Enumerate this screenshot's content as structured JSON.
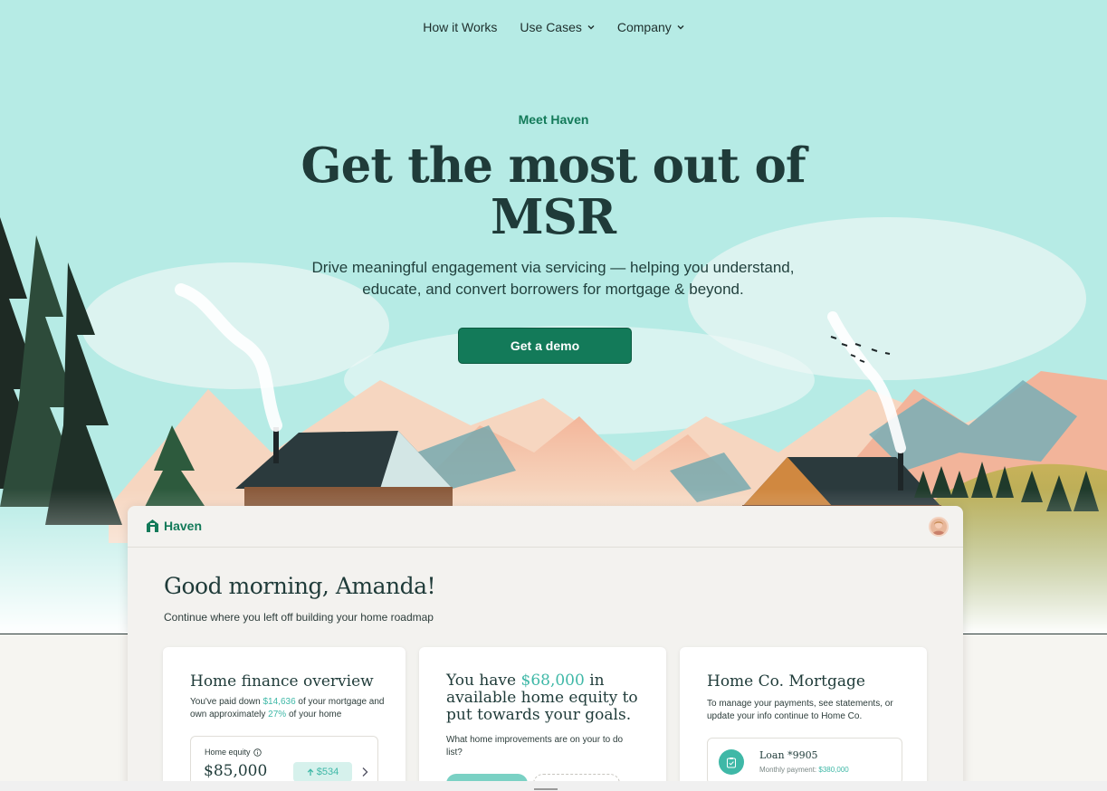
{
  "nav": {
    "items": [
      {
        "label": "How it Works",
        "has_dropdown": false
      },
      {
        "label": "Use Cases",
        "has_dropdown": true
      },
      {
        "label": "Company",
        "has_dropdown": true
      }
    ]
  },
  "hero": {
    "eyebrow": "Meet Haven",
    "headline_line1": "Get the most out of",
    "headline_line2": "MSR",
    "subhead_line1": "Drive meaningful engagement via servicing — helping you understand,",
    "subhead_line2": "educate, and convert borrowers for mortgage & beyond.",
    "cta_label": "Get a demo"
  },
  "app": {
    "logo_text": "Haven",
    "greeting": "Good morning, Amanda!",
    "greeting_sub": "Continue where you left off building your home roadmap",
    "finance_card": {
      "title": "Home finance overview",
      "text_a": "You've paid down ",
      "paid": "$14,636",
      "text_b": " of your mortgage and own approximately ",
      "pct": "27%",
      "text_c": " of your home",
      "equity_label": "Home equity",
      "equity_value": "$85,000",
      "equity_delta": "$534"
    },
    "equity_card": {
      "title_a": "You have ",
      "amount": "$68,000",
      "title_b": " in available home equity to put towards your goals.",
      "question": "What home improvements are on your to do list?"
    },
    "mortgage_card": {
      "title": "Home Co. Mortgage",
      "text": "To manage your payments, see statements, or update your info continue to Home Co.",
      "loan_title": "Loan *9905",
      "payment_label": "Monthly payment: ",
      "payment_value": "$380,000"
    }
  },
  "colors": {
    "sky": "#b6ebe5",
    "brand_green": "#137a59",
    "accent_teal": "#3fb8a7",
    "ink": "#1f3b39"
  }
}
